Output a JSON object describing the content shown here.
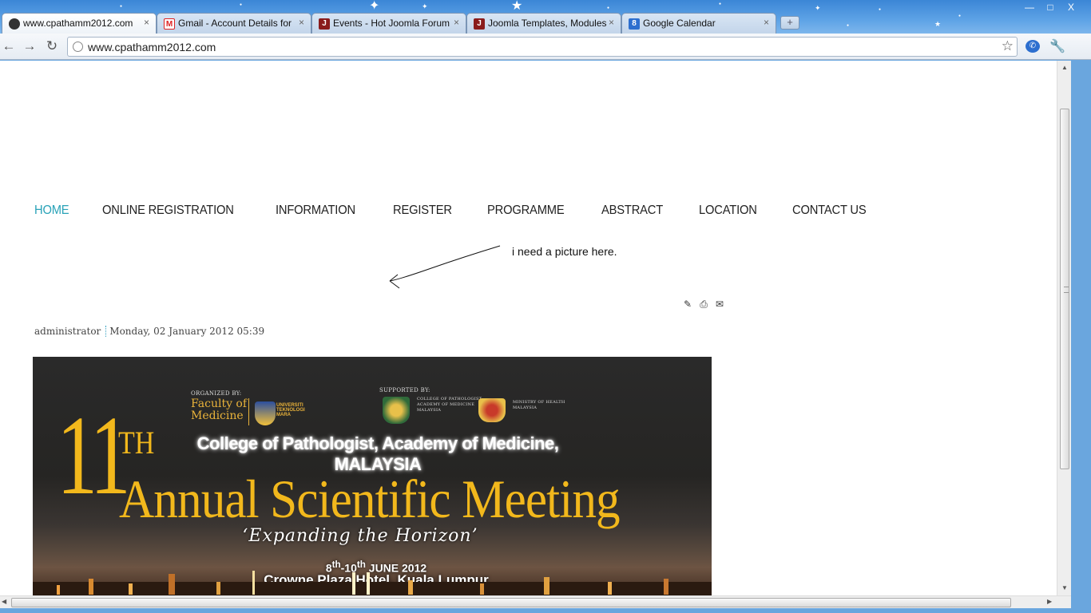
{
  "browser": {
    "tabs": [
      {
        "label": "www.cpathamm2012.com",
        "favicon": "site-favicon",
        "active": true
      },
      {
        "label": "Gmail - Account Details for",
        "favicon": "gmail-favicon",
        "active": false
      },
      {
        "label": "Events - Hot Joomla Forum",
        "favicon": "joomla-favicon",
        "active": false
      },
      {
        "label": "Joomla Templates, Modules",
        "favicon": "joomla-favicon",
        "active": false
      },
      {
        "label": "Google Calendar",
        "favicon": "calendar-favicon",
        "active": false
      }
    ],
    "tab_close_glyph": "×",
    "new_tab_glyph": "+",
    "address": "www.cpathamm2012.com",
    "window_controls": {
      "minimize": "—",
      "maximize": "□",
      "close": "X"
    },
    "calendar_favicon_text": "8",
    "gmail_favicon_text": "M",
    "joomla_favicon_text": "J"
  },
  "page": {
    "menu": [
      {
        "label": "HOME",
        "active": true
      },
      {
        "label": "ONLINE REGISTRATION",
        "active": false
      },
      {
        "label": "INFORMATION",
        "active": false
      },
      {
        "label": "REGISTER",
        "active": false
      },
      {
        "label": "PROGRAMME",
        "active": false
      },
      {
        "label": "ABSTRACT",
        "active": false
      },
      {
        "label": "LOCATION",
        "active": false
      },
      {
        "label": "CONTACT US",
        "active": false
      }
    ],
    "annotation": "i need a picture here.",
    "article": {
      "author": "administrator",
      "date": "Monday, 02 January 2012 05:39",
      "icons": [
        "edit-icon",
        "print-icon",
        "email-icon"
      ]
    },
    "banner": {
      "organized_by": "ORGANIZED BY:",
      "faculty_line1": "Faculty of",
      "faculty_line2": "Medicine",
      "university_line1": "UNIVERSITI",
      "university_line2": "TEKNOLOGI",
      "university_line3": "MARA",
      "supported_by": "SUPPORTED BY:",
      "college_small_1": "COLLEGE OF PATHOLOGIST",
      "college_small_2": "ACADEMY OF MEDICINE",
      "college_small_3": "MALAYSIA",
      "ministry_1": "MINISTRY OF HEALTH",
      "ministry_2": "MALAYSIA",
      "ordinal_number": "11",
      "ordinal_suffix": "TH",
      "college_line1": "College of Pathologist, Academy of Medicine,",
      "college_line2": "MALAYSIA",
      "title": "Annual Scientific Meeting",
      "theme": "‘Expanding the Horizon’",
      "dates_d1": "8",
      "dates_s1": "th",
      "dates_dash": "-10",
      "dates_s2": "th",
      "dates_rest": " JUNE 2012",
      "venue": "Crowne Plaza Hotel, Kuala Lumpur"
    }
  },
  "colors": {
    "menu_active": "#2aa3b8",
    "banner_gold": "#f2b81c",
    "frame_blue": "#6aa6de"
  }
}
